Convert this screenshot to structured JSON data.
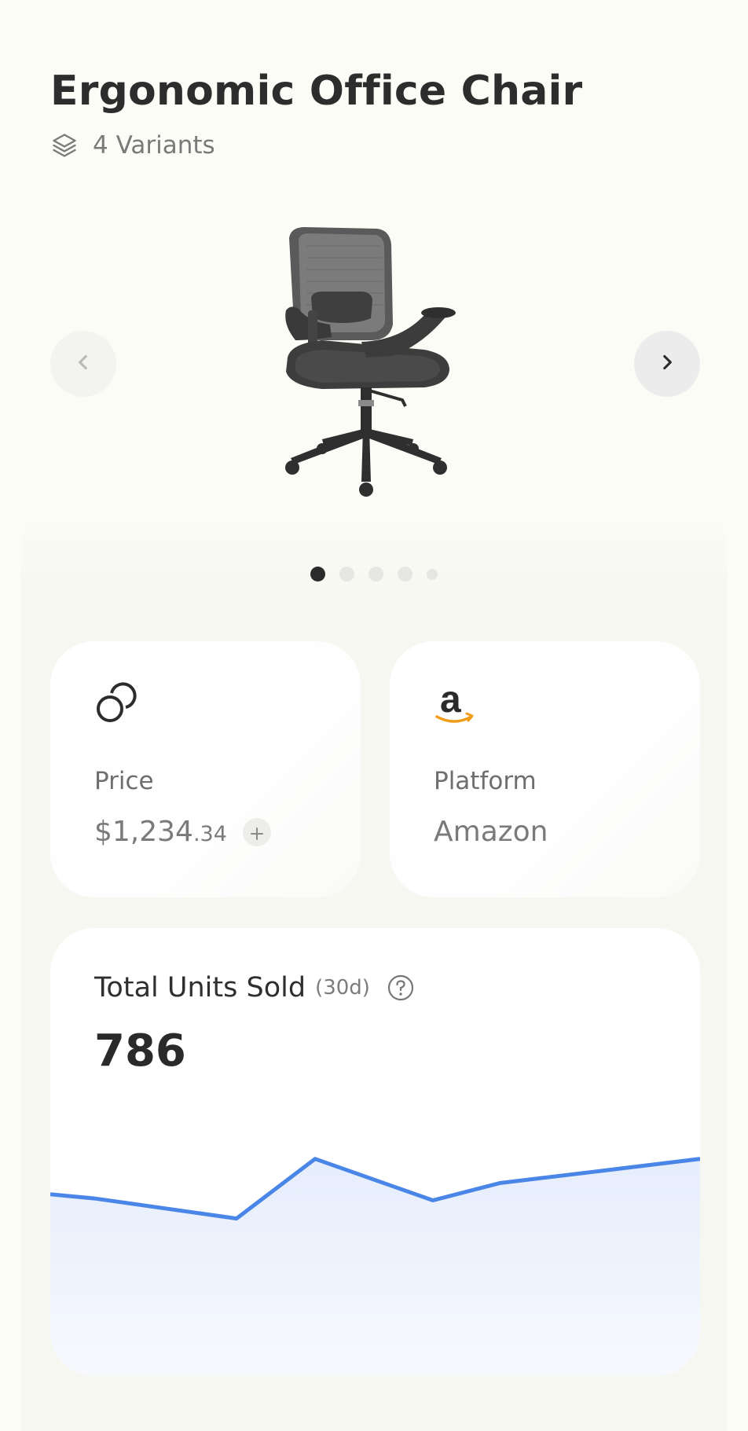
{
  "product": {
    "title": "Ergonomic Office Chair",
    "variants_label": "4 Variants",
    "image_name": "office-chair"
  },
  "carousel": {
    "slide_count": 5,
    "active_index": 0,
    "prev_icon": "chevron-left-icon",
    "next_icon": "chevron-right-icon"
  },
  "price_card": {
    "icon": "coins-icon",
    "label": "Price",
    "value_main": "$1,234",
    "value_cents": ".34",
    "action_icon": "plus-icon"
  },
  "platform_card": {
    "icon": "amazon-logo",
    "label": "Platform",
    "value": "Amazon"
  },
  "sales_card": {
    "title": "Total Units Sold",
    "period": "(30d)",
    "help_icon": "help-circle-icon",
    "value": "786"
  },
  "chart_data": {
    "type": "area",
    "title": "",
    "xlabel": "",
    "ylabel": "",
    "x": [
      0,
      1,
      2,
      3,
      4,
      5,
      6,
      7
    ],
    "values": [
      32,
      27,
      4,
      73,
      25,
      45,
      59,
      73
    ],
    "ylim": [
      0,
      100
    ],
    "series_color": "#4a86e8",
    "fill_color": "#e8eefb"
  },
  "colors": {
    "background": "#fcfcf6",
    "text_primary": "#2d2d2d",
    "text_secondary": "#7a7a7a",
    "accent": "#4a86e8",
    "amazon_orange": "#f29d1a"
  }
}
